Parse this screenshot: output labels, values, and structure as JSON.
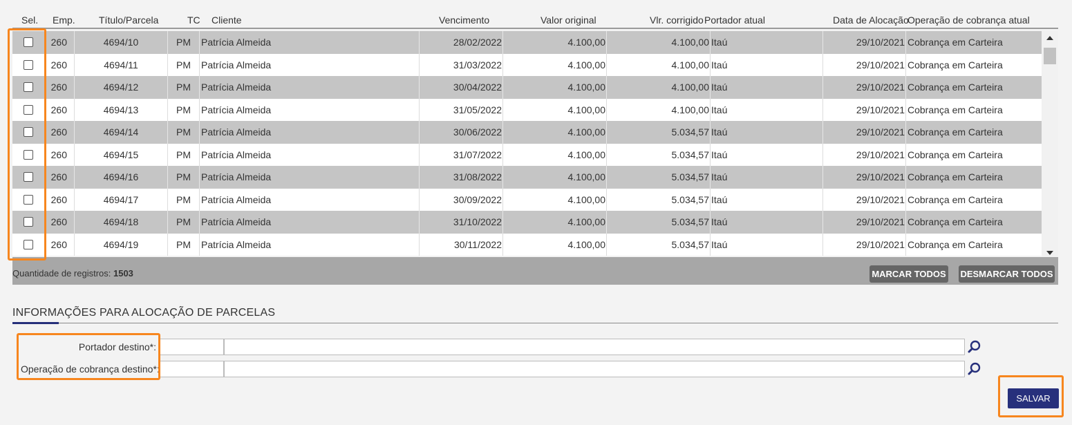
{
  "grid": {
    "headers": {
      "sel": "Sel.",
      "emp": "Emp.",
      "titulo": "Título/Parcela",
      "tc": "TC",
      "cliente": "Cliente",
      "vencimento": "Vencimento",
      "valor_original": "Valor original",
      "vlr_corrigido": "Vlr. corrigido",
      "portador": "Portador atual",
      "data_alocacao": "Data de Alocação",
      "operacao": "Operação de cobrança atual"
    },
    "rows": [
      {
        "emp": "260",
        "titulo": "4694/10",
        "tc": "PM",
        "cliente": "Patrícia Almeida",
        "vencimento": "28/02/2022",
        "valor_original": "4.100,00",
        "vlr_corrigido": "4.100,00",
        "portador": "Itaú",
        "data_alocacao": "29/10/2021",
        "operacao": "Cobrança em Carteira"
      },
      {
        "emp": "260",
        "titulo": "4694/11",
        "tc": "PM",
        "cliente": "Patrícia Almeida",
        "vencimento": "31/03/2022",
        "valor_original": "4.100,00",
        "vlr_corrigido": "4.100,00",
        "portador": "Itaú",
        "data_alocacao": "29/10/2021",
        "operacao": "Cobrança em Carteira"
      },
      {
        "emp": "260",
        "titulo": "4694/12",
        "tc": "PM",
        "cliente": "Patrícia Almeida",
        "vencimento": "30/04/2022",
        "valor_original": "4.100,00",
        "vlr_corrigido": "4.100,00",
        "portador": "Itaú",
        "data_alocacao": "29/10/2021",
        "operacao": "Cobrança em Carteira"
      },
      {
        "emp": "260",
        "titulo": "4694/13",
        "tc": "PM",
        "cliente": "Patrícia Almeida",
        "vencimento": "31/05/2022",
        "valor_original": "4.100,00",
        "vlr_corrigido": "4.100,00",
        "portador": "Itaú",
        "data_alocacao": "29/10/2021",
        "operacao": "Cobrança em Carteira"
      },
      {
        "emp": "260",
        "titulo": "4694/14",
        "tc": "PM",
        "cliente": "Patrícia Almeida",
        "vencimento": "30/06/2022",
        "valor_original": "4.100,00",
        "vlr_corrigido": "5.034,57",
        "portador": "Itaú",
        "data_alocacao": "29/10/2021",
        "operacao": "Cobrança em Carteira"
      },
      {
        "emp": "260",
        "titulo": "4694/15",
        "tc": "PM",
        "cliente": "Patrícia Almeida",
        "vencimento": "31/07/2022",
        "valor_original": "4.100,00",
        "vlr_corrigido": "5.034,57",
        "portador": "Itaú",
        "data_alocacao": "29/10/2021",
        "operacao": "Cobrança em Carteira"
      },
      {
        "emp": "260",
        "titulo": "4694/16",
        "tc": "PM",
        "cliente": "Patrícia Almeida",
        "vencimento": "31/08/2022",
        "valor_original": "4.100,00",
        "vlr_corrigido": "5.034,57",
        "portador": "Itaú",
        "data_alocacao": "29/10/2021",
        "operacao": "Cobrança em Carteira"
      },
      {
        "emp": "260",
        "titulo": "4694/17",
        "tc": "PM",
        "cliente": "Patrícia Almeida",
        "vencimento": "30/09/2022",
        "valor_original": "4.100,00",
        "vlr_corrigido": "5.034,57",
        "portador": "Itaú",
        "data_alocacao": "29/10/2021",
        "operacao": "Cobrança em Carteira"
      },
      {
        "emp": "260",
        "titulo": "4694/18",
        "tc": "PM",
        "cliente": "Patrícia Almeida",
        "vencimento": "31/10/2022",
        "valor_original": "4.100,00",
        "vlr_corrigido": "5.034,57",
        "portador": "Itaú",
        "data_alocacao": "29/10/2021",
        "operacao": "Cobrança em Carteira"
      },
      {
        "emp": "260",
        "titulo": "4694/19",
        "tc": "PM",
        "cliente": "Patrícia Almeida",
        "vencimento": "30/11/2022",
        "valor_original": "4.100,00",
        "vlr_corrigido": "5.034,57",
        "portador": "Itaú",
        "data_alocacao": "29/10/2021",
        "operacao": "Cobrança em Carteira"
      }
    ]
  },
  "footer": {
    "count_label": "Quantidade de registros: ",
    "count_value": "1503",
    "mark_all": "MARCAR TODOS",
    "unmark_all": "DESMARCAR TODOS"
  },
  "section": {
    "title": "INFORMAÇÕES PARA ALOCAÇÃO DE PARCELAS"
  },
  "form": {
    "portador_label": "Portador destino*:",
    "operacao_label": "Operação de cobrança destino*:",
    "portador_code": "",
    "portador_desc": "",
    "operacao_code": "",
    "operacao_desc": ""
  },
  "actions": {
    "save": "SALVAR"
  },
  "icons": {
    "search": "search-icon",
    "scroll_up": "arrow-up-icon",
    "scroll_down": "arrow-down-icon"
  },
  "colors": {
    "primary": "#27307c",
    "highlight": "#f7861e",
    "row_alt": "#c5c5c5",
    "footer_bar": "#a7a7a7"
  }
}
